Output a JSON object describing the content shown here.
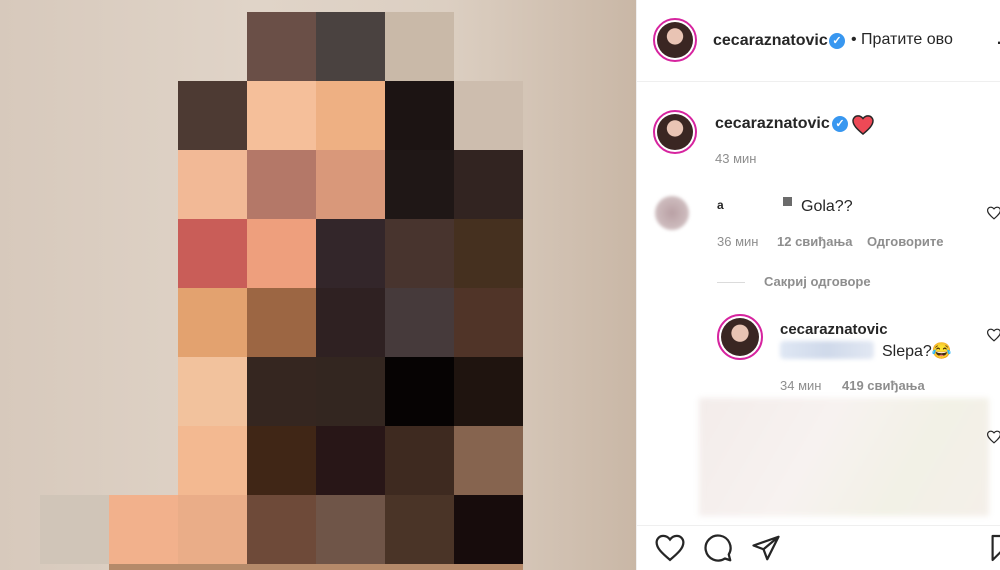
{
  "post": {
    "username": "cecaraznatovic",
    "follow_label": "• Пратите ово"
  },
  "caption": {
    "username": "cecaraznatovic",
    "time": "43 мин"
  },
  "comment": {
    "username_partial": "а",
    "text": "Gola??",
    "time": "36 мин",
    "likes": "12 свиђања",
    "reply_label": "Одговорите"
  },
  "replies_toggle": "Сакриј одговоре",
  "reply": {
    "username": "cecaraznatovic",
    "text": "Slepa?😂",
    "time": "34 мин",
    "likes": "419 свиђања"
  },
  "colors": {
    "verified": "#3897f0",
    "heart": "#ed4956",
    "text": "#262626",
    "muted": "#8e8e8e"
  }
}
